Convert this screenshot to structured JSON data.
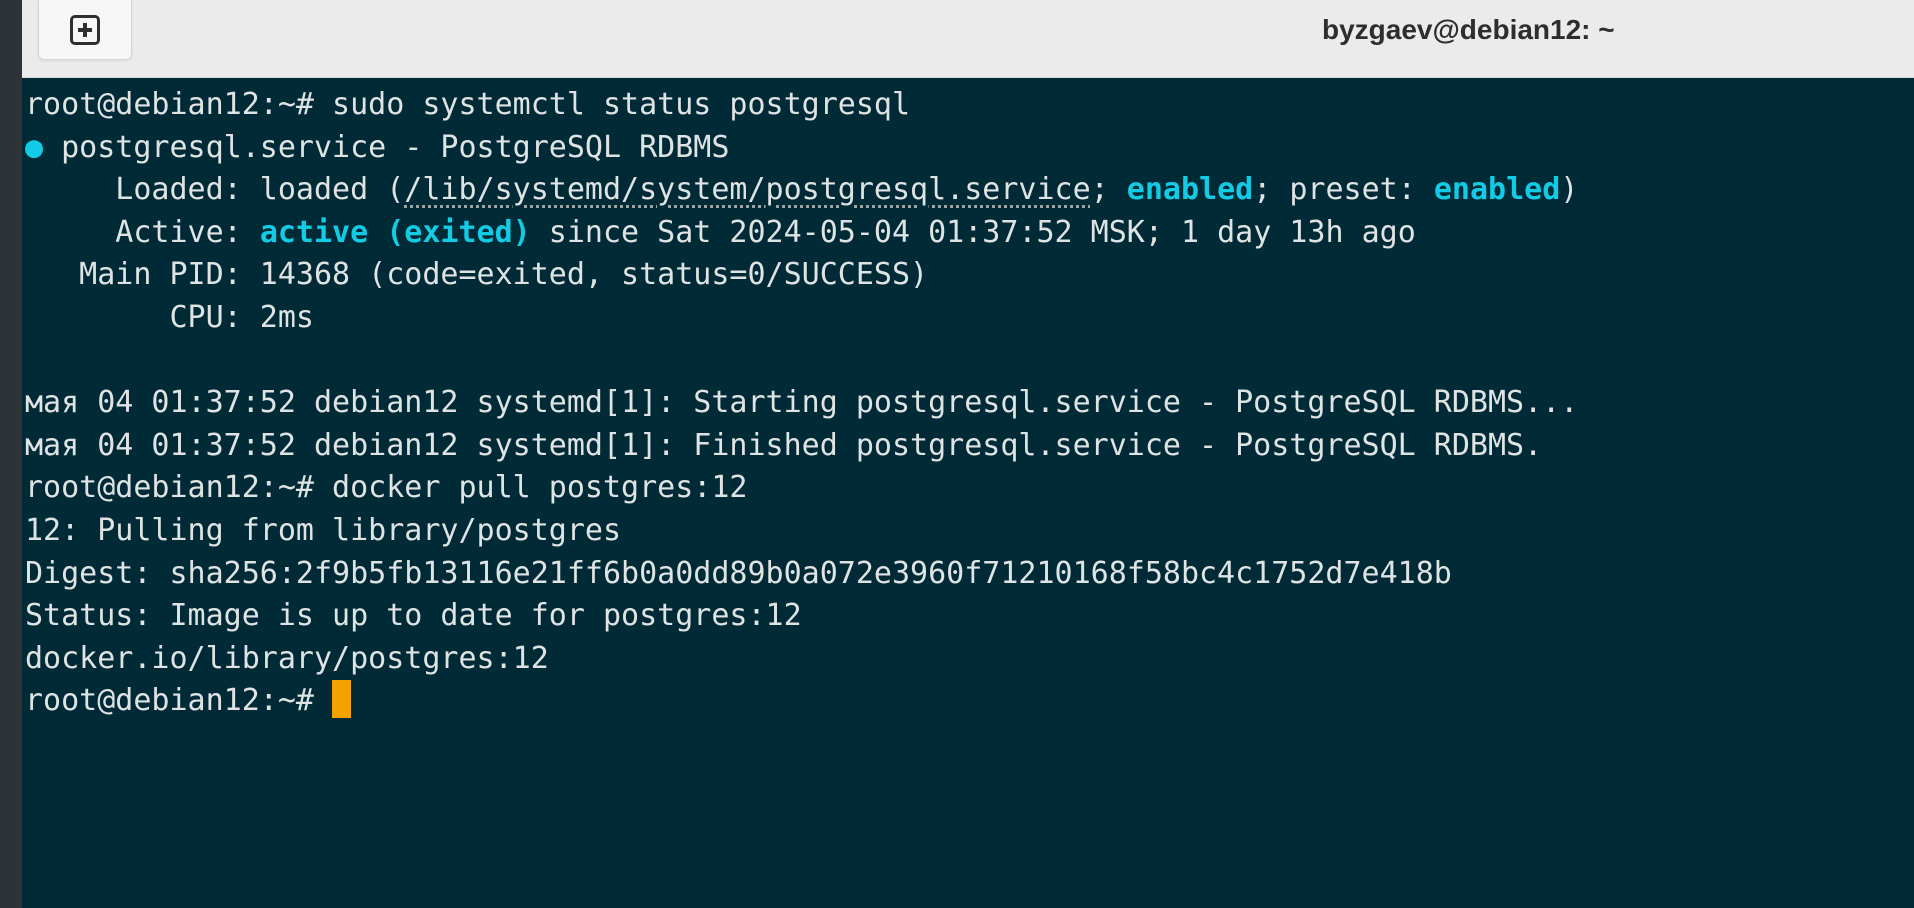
{
  "window": {
    "title": "byzgaev@debian12: ~",
    "new_tab_icon": "plus-square-icon"
  },
  "terminal": {
    "prompt": "root@debian12:~# ",
    "cmd1": "sudo systemctl status postgresql",
    "bullet": "●",
    "service_line": " postgresql.service - PostgreSQL RDBMS",
    "loaded_label": "     Loaded: loaded (",
    "loaded_path": "/lib/systemd/system/postgresql.service",
    "loaded_sep": "; ",
    "enabled1": "enabled",
    "preset_label": "; preset: ",
    "enabled2": "enabled",
    "loaded_close": ")",
    "active_label": "     Active: ",
    "active_state": "active (exited)",
    "active_since": " since Sat 2024-05-04 01:37:52 MSK; 1 day 13h ago",
    "main_pid": "   Main PID: 14368 (code=exited, status=0/SUCCESS)",
    "cpu": "        CPU: 2ms",
    "log1": "мая 04 01:37:52 debian12 systemd[1]: Starting postgresql.service - PostgreSQL RDBMS...",
    "log2": "мая 04 01:37:52 debian12 systemd[1]: Finished postgresql.service - PostgreSQL RDBMS.",
    "cmd2": "docker pull postgres:12",
    "pull1": "12: Pulling from library/postgres",
    "pull2": "Digest: sha256:2f9b5fb13116e21ff6b0a0dd89b0a072e3960f71210168f58bc4c1752d7e418b",
    "pull3": "Status: Image is up to date for postgres:12",
    "pull4": "docker.io/library/postgres:12"
  },
  "colors": {
    "terminal_bg": "#002b36",
    "text": "#dfe3e4",
    "highlight": "#12cbe4",
    "cursor": "#f5a100",
    "titlebar_bg": "#ebebeb"
  }
}
